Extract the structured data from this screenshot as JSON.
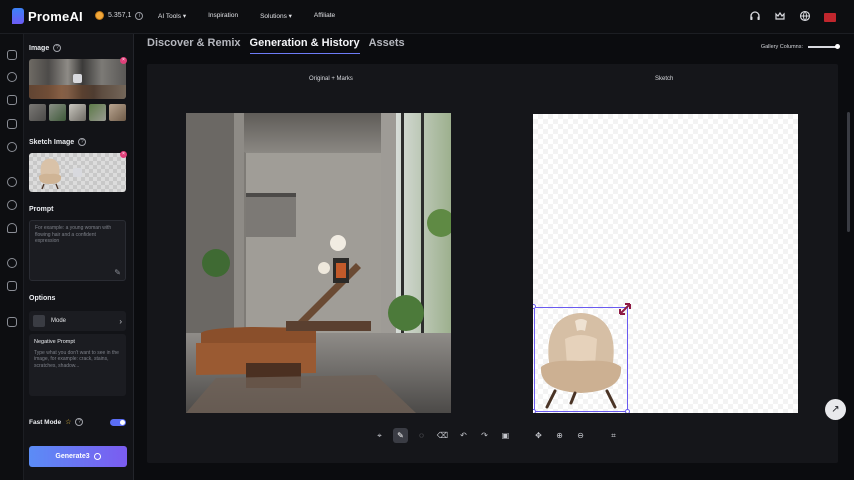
{
  "app": {
    "name": "PromeAI",
    "credits": "5.357,1"
  },
  "nav": {
    "items": [
      "AI Tools",
      "Inspiration",
      "Solutions",
      "Affiliate"
    ]
  },
  "sidebar": {
    "image_title": "Image",
    "sketch_title": "Sketch Image",
    "prompt_title": "Prompt",
    "prompt_placeholder": "For example: a young woman with flowing hair and a confident expression",
    "options_title": "Options",
    "mode_label": "Mode",
    "negative_prompt_title": "Negative Prompt",
    "negative_prompt_placeholder": "Type what you don't want to see in the image, for example: crack, stains, scratches, shadow...",
    "fast_mode_label": "Fast Mode",
    "fast_mode_on": true,
    "generate_label": "Generate3"
  },
  "tabs": [
    {
      "label": "Discover & Remix",
      "active": false
    },
    {
      "label": "Generation & History",
      "active": true
    },
    {
      "label": "Assets",
      "active": false
    }
  ],
  "gallery": {
    "columns_label": "Gallery Columns:"
  },
  "canvas": {
    "left_label": "Original + Marks",
    "right_label": "Sketch"
  },
  "toolbar": {
    "tools": [
      "select-icon",
      "brush-icon",
      "lasso-icon",
      "eraser-icon",
      "undo-icon",
      "redo-icon",
      "save-icon",
      "move-icon",
      "zoom-in-icon",
      "zoom-out-icon",
      "crop-icon"
    ],
    "active_tool": "brush-icon"
  },
  "colors": {
    "accent": "#6d7cf7",
    "generate_start": "#5b8cf6",
    "generate_end": "#7b5cf0",
    "selection": "#6a5af0"
  }
}
